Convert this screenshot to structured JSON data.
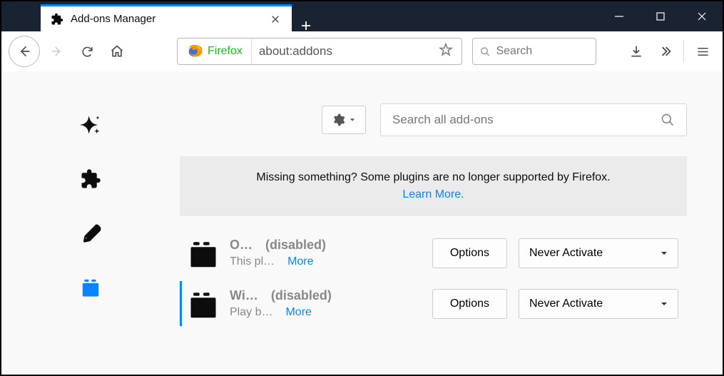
{
  "titlebar": {
    "tab_title": "Add-ons Manager"
  },
  "nav": {
    "identity_label": "Firefox",
    "url": "about:addons",
    "search_placeholder": "Search"
  },
  "addons": {
    "search_placeholder": "Search all add-ons",
    "notice": "Missing something? Some plugins are no longer supported by Firefox.",
    "learn_more": "Learn More.",
    "options_label": "Options",
    "more_label": "More",
    "disabled_label": "(disabled)",
    "plugins": [
      {
        "name": "O…",
        "desc": "This pl…",
        "activate": "Never Activate",
        "highlighted": false
      },
      {
        "name": "Wi…",
        "desc": "Play b…",
        "activate": "Never Activate",
        "highlighted": true
      }
    ]
  }
}
